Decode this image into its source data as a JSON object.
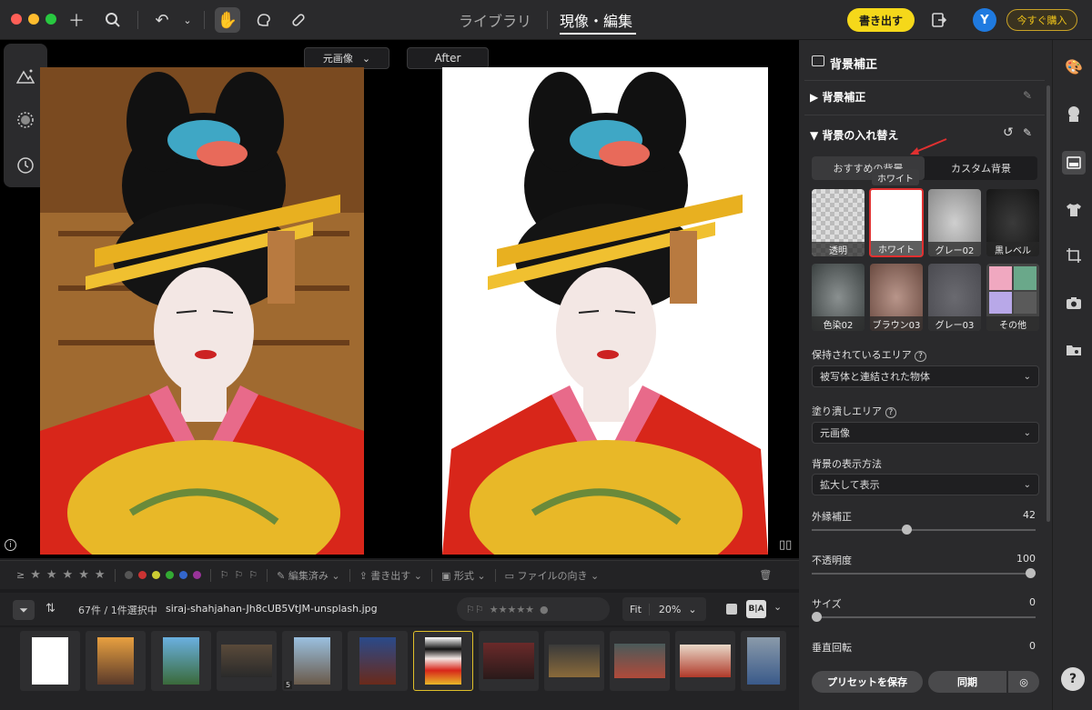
{
  "topbar": {
    "nav_library": "ライブラリ",
    "nav_develop": "現像・編集",
    "export_label": "書き出す",
    "avatar_initial": "Y",
    "buy_label": "今すぐ購入"
  },
  "canvas": {
    "view_select": "元画像",
    "after_label": "After"
  },
  "filters": {
    "ge": "≥",
    "edited": "編集済み",
    "export": "書き出す",
    "format": "形式",
    "orientation": "ファイルの向き"
  },
  "filebar": {
    "count": "67件 / 1件選択中",
    "filename": "siraj-shahjahan-Jh8cUB5VtJM-unsplash.jpg",
    "fit": "Fit",
    "zoom": "20%",
    "stack_count": "5"
  },
  "panel": {
    "title": "背景補正",
    "section_bg_correct": "背景補正",
    "section_bg_replace": "背景の入れ替え",
    "tab_recommended": "おすすめの背景",
    "tab_custom": "カスタム背景",
    "tooltip": "ホワイト",
    "tiles": [
      "透明",
      "ホワイト",
      "グレー02",
      "黒レベル",
      "色染02",
      "ブラウン03",
      "グレー03",
      "その他"
    ],
    "keep_area_label": "保持されているエリア",
    "keep_area_value": "被写体と連結された物体",
    "fill_area_label": "塗り潰しエリア",
    "fill_area_value": "元画像",
    "display_label": "背景の表示方法",
    "display_value": "拡大して表示",
    "edge_label": "外縁補正",
    "edge_value": "42",
    "edge_fraction": 0.42,
    "opacity_label": "不透明度",
    "opacity_value": "100",
    "opacity_fraction": 1.0,
    "size_label": "サイズ",
    "size_value": "0",
    "size_fraction": 0,
    "vrot_label": "垂直回転",
    "vrot_value": "0",
    "save_preset": "プリセットを保存",
    "sync": "同期"
  },
  "colors": {
    "accent_yellow": "#f5d81a",
    "highlight_red": "#e03030",
    "avatar_blue": "#1f7ae0"
  }
}
